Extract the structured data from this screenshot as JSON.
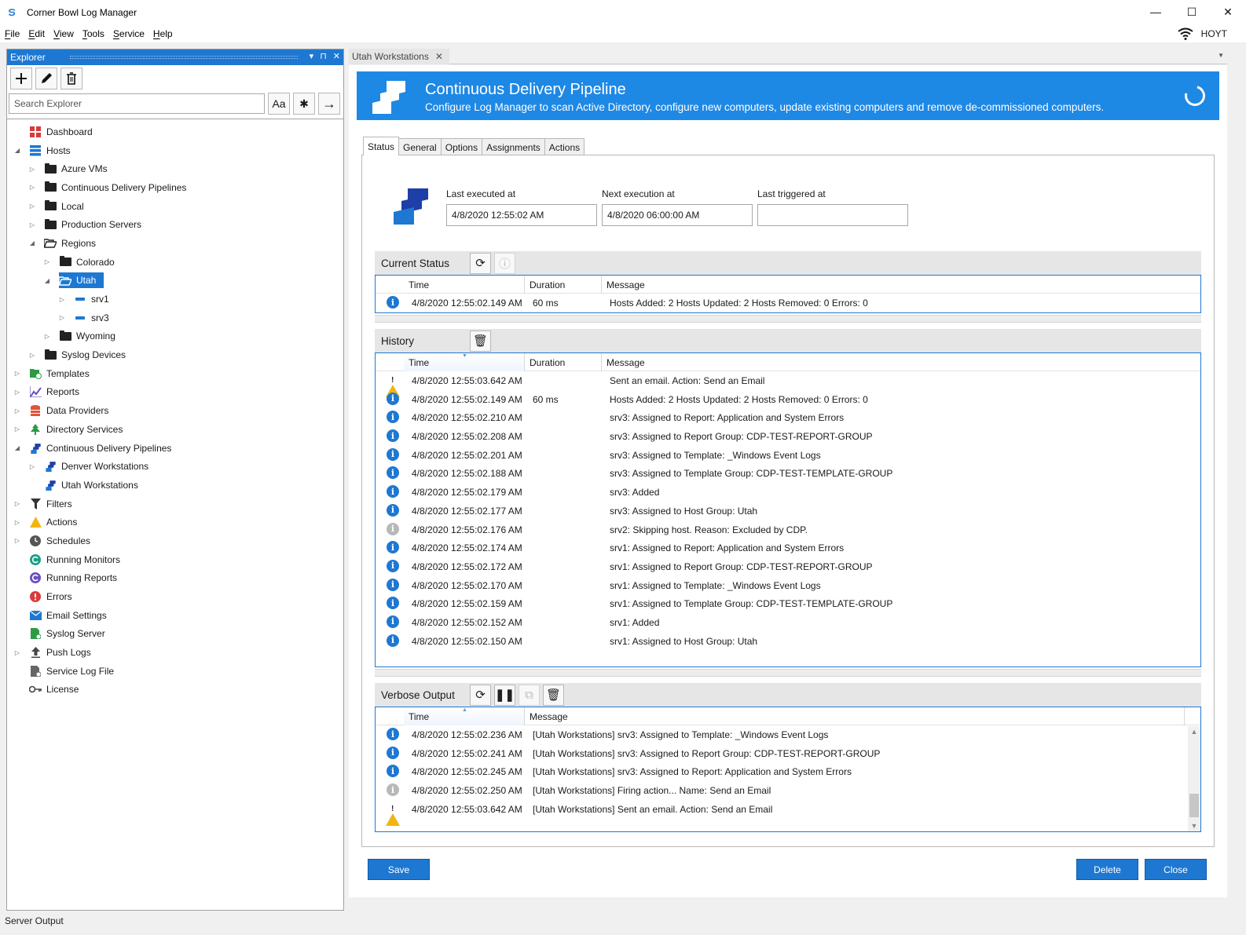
{
  "window": {
    "title": "Corner Bowl Log Manager",
    "minimize": "—",
    "maximize": "☐",
    "close": "✕"
  },
  "menu": [
    "File",
    "Edit",
    "View",
    "Tools",
    "Service",
    "Help"
  ],
  "server": "HOYT",
  "explorer": {
    "title": "Explorer",
    "pin": "⊓",
    "dropdown": "▾",
    "close": "✕",
    "search_placeholder": "Search Explorer",
    "match_case": "Aa",
    "regex": "✱",
    "go": "→",
    "tree": [
      {
        "label": "Dashboard",
        "depth": 0,
        "arrow": "",
        "icon": "dashboard"
      },
      {
        "label": "Hosts",
        "depth": 0,
        "arrow": "◢",
        "icon": "hosts"
      },
      {
        "label": "Azure VMs",
        "depth": 1,
        "arrow": "▷",
        "icon": "folder"
      },
      {
        "label": "Continuous Delivery Pipelines",
        "depth": 1,
        "arrow": "▷",
        "icon": "folder"
      },
      {
        "label": "Local",
        "depth": 1,
        "arrow": "▷",
        "icon": "folder"
      },
      {
        "label": "Production Servers",
        "depth": 1,
        "arrow": "▷",
        "icon": "folder"
      },
      {
        "label": "Regions",
        "depth": 1,
        "arrow": "◢",
        "icon": "folder-open"
      },
      {
        "label": "Colorado",
        "depth": 2,
        "arrow": "▷",
        "icon": "folder"
      },
      {
        "label": "Utah",
        "depth": 2,
        "arrow": "◢",
        "icon": "folder-open",
        "selected": true
      },
      {
        "label": "srv1",
        "depth": 3,
        "arrow": "▷",
        "icon": "server"
      },
      {
        "label": "srv3",
        "depth": 3,
        "arrow": "▷",
        "icon": "server"
      },
      {
        "label": "Wyoming",
        "depth": 2,
        "arrow": "▷",
        "icon": "folder"
      },
      {
        "label": "Syslog Devices",
        "depth": 1,
        "arrow": "▷",
        "icon": "folder"
      },
      {
        "label": "Templates",
        "depth": 0,
        "arrow": "▷",
        "icon": "templates"
      },
      {
        "label": "Reports",
        "depth": 0,
        "arrow": "▷",
        "icon": "reports"
      },
      {
        "label": "Data Providers",
        "depth": 0,
        "arrow": "▷",
        "icon": "data-providers"
      },
      {
        "label": "Directory Services",
        "depth": 0,
        "arrow": "▷",
        "icon": "directory-services"
      },
      {
        "label": "Continuous Delivery Pipelines",
        "depth": 0,
        "arrow": "◢",
        "icon": "pipeline"
      },
      {
        "label": "Denver Workstations",
        "depth": 1,
        "arrow": "▷",
        "icon": "pipeline"
      },
      {
        "label": "Utah Workstations",
        "depth": 1,
        "arrow": "",
        "icon": "pipeline"
      },
      {
        "label": "Filters",
        "depth": 0,
        "arrow": "▷",
        "icon": "filter"
      },
      {
        "label": "Actions",
        "depth": 0,
        "arrow": "▷",
        "icon": "actions"
      },
      {
        "label": "Schedules",
        "depth": 0,
        "arrow": "▷",
        "icon": "schedules"
      },
      {
        "label": "Running Monitors",
        "depth": 0,
        "arrow": "",
        "icon": "running-monitors"
      },
      {
        "label": "Running Reports",
        "depth": 0,
        "arrow": "",
        "icon": "running-reports"
      },
      {
        "label": "Errors",
        "depth": 0,
        "arrow": "",
        "icon": "errors"
      },
      {
        "label": "Email Settings",
        "depth": 0,
        "arrow": "",
        "icon": "email"
      },
      {
        "label": "Syslog Server",
        "depth": 0,
        "arrow": "",
        "icon": "syslog-server"
      },
      {
        "label": "Push Logs",
        "depth": 0,
        "arrow": "▷",
        "icon": "push-logs"
      },
      {
        "label": "Service Log File",
        "depth": 0,
        "arrow": "",
        "icon": "service-log-file"
      },
      {
        "label": "License",
        "depth": 0,
        "arrow": "",
        "icon": "license"
      }
    ]
  },
  "server_output": "Server Output",
  "document_tab": {
    "label": "Utah Workstations",
    "close": "✕"
  },
  "banner": {
    "title": "Continuous Delivery Pipeline",
    "subtitle": "Configure Log Manager to scan Active Directory, configure new computers, update existing computers and remove de-commissioned computers."
  },
  "tabs": [
    "Status",
    "General",
    "Options",
    "Assignments",
    "Actions"
  ],
  "active_tab": "Status",
  "execution": {
    "last_executed_label": "Last executed at",
    "last_executed_value": "4/8/2020 12:55:02 AM",
    "next_execution_label": "Next execution at",
    "next_execution_value": "4/8/2020 06:00:00 AM",
    "last_triggered_label": "Last triggered at",
    "last_triggered_value": ""
  },
  "current_status": {
    "title": "Current Status",
    "columns": [
      "Time",
      "Duration",
      "Message"
    ],
    "rows": [
      {
        "level": "info",
        "time": "4/8/2020 12:55:02.149 AM",
        "duration": "60 ms",
        "message": "Hosts Added: 2  Hosts Updated: 2  Hosts Removed: 0  Errors: 0"
      }
    ]
  },
  "history": {
    "title": "History",
    "columns": [
      "Time",
      "Duration",
      "Message"
    ],
    "rows": [
      {
        "level": "warning",
        "time": "4/8/2020 12:55:03.642 AM",
        "duration": "",
        "message": "Sent an email.  Action: Send an Email"
      },
      {
        "level": "info",
        "time": "4/8/2020 12:55:02.149 AM",
        "duration": "60 ms",
        "message": "Hosts Added: 2  Hosts Updated: 2  Hosts Removed: 0  Errors: 0"
      },
      {
        "level": "info",
        "time": "4/8/2020 12:55:02.210 AM",
        "duration": "",
        "message": "srv3:  Assigned to Report: Application and System Errors"
      },
      {
        "level": "info",
        "time": "4/8/2020 12:55:02.208 AM",
        "duration": "",
        "message": "srv3:  Assigned to Report Group: CDP-TEST-REPORT-GROUP"
      },
      {
        "level": "info",
        "time": "4/8/2020 12:55:02.201 AM",
        "duration": "",
        "message": "srv3:  Assigned to Template: _Windows Event Logs"
      },
      {
        "level": "info",
        "time": "4/8/2020 12:55:02.188 AM",
        "duration": "",
        "message": "srv3:  Assigned to Template Group: CDP-TEST-TEMPLATE-GROUP"
      },
      {
        "level": "info",
        "time": "4/8/2020 12:55:02.179 AM",
        "duration": "",
        "message": "srv3:  Added"
      },
      {
        "level": "info",
        "time": "4/8/2020 12:55:02.177 AM",
        "duration": "",
        "message": "srv3:  Assigned to Host Group: Utah"
      },
      {
        "level": "muted",
        "time": "4/8/2020 12:55:02.176 AM",
        "duration": "",
        "message": "srv2:  Skipping host.  Reason:  Excluded by CDP."
      },
      {
        "level": "info",
        "time": "4/8/2020 12:55:02.174 AM",
        "duration": "",
        "message": "srv1:  Assigned to Report: Application and System Errors"
      },
      {
        "level": "info",
        "time": "4/8/2020 12:55:02.172 AM",
        "duration": "",
        "message": "srv1:  Assigned to Report Group: CDP-TEST-REPORT-GROUP"
      },
      {
        "level": "info",
        "time": "4/8/2020 12:55:02.170 AM",
        "duration": "",
        "message": "srv1:  Assigned to Template: _Windows Event Logs"
      },
      {
        "level": "info",
        "time": "4/8/2020 12:55:02.159 AM",
        "duration": "",
        "message": "srv1:  Assigned to Template Group: CDP-TEST-TEMPLATE-GROUP"
      },
      {
        "level": "info",
        "time": "4/8/2020 12:55:02.152 AM",
        "duration": "",
        "message": "srv1:  Added"
      },
      {
        "level": "info",
        "time": "4/8/2020 12:55:02.150 AM",
        "duration": "",
        "message": "srv1:  Assigned to Host Group: Utah"
      }
    ]
  },
  "verbose": {
    "title": "Verbose Output",
    "columns": [
      "Time",
      "Message"
    ],
    "rows": [
      {
        "level": "info",
        "time": "4/8/2020 12:55:02.236 AM",
        "message": "[Utah Workstations] srv3:  Assigned to Template: _Windows Event Logs"
      },
      {
        "level": "info",
        "time": "4/8/2020 12:55:02.241 AM",
        "message": "[Utah Workstations] srv3:  Assigned to Report Group: CDP-TEST-REPORT-GROUP"
      },
      {
        "level": "info",
        "time": "4/8/2020 12:55:02.245 AM",
        "message": "[Utah Workstations] srv3:  Assigned to Report: Application and System Errors"
      },
      {
        "level": "muted",
        "time": "4/8/2020 12:55:02.250 AM",
        "message": "[Utah Workstations] Firing action...  Name: Send an Email"
      },
      {
        "level": "warning",
        "time": "4/8/2020 12:55:03.642 AM",
        "message": "[Utah Workstations] Sent an email.  Action: Send an Email"
      }
    ]
  },
  "buttons": {
    "save": "Save",
    "delete": "Delete",
    "close": "Close"
  },
  "colors": {
    "accent": "#1e78d2",
    "banner": "#1e88e5",
    "warning": "#f2b410"
  }
}
